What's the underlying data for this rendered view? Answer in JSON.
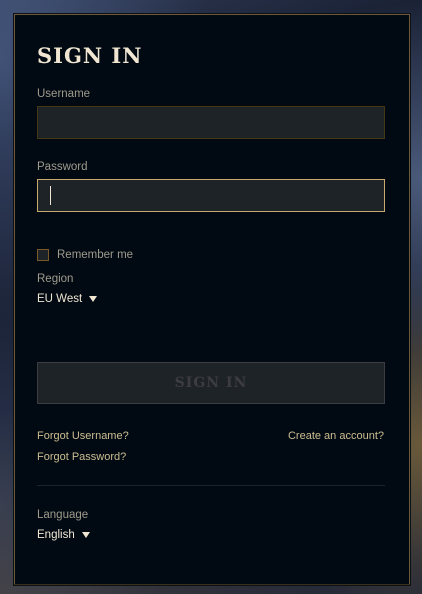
{
  "form": {
    "title": "SIGN IN",
    "username": {
      "label": "Username",
      "value": "",
      "placeholder": ""
    },
    "password": {
      "label": "Password",
      "value": "",
      "placeholder": ""
    },
    "remember_label": "Remember me",
    "remember_checked": false,
    "region": {
      "label": "Region",
      "value": "EU West"
    },
    "submit_label": "SIGN IN",
    "forgot_username": "Forgot Username?",
    "forgot_password": "Forgot Password?",
    "create_account": "Create an account?",
    "language": {
      "label": "Language",
      "value": "English"
    }
  },
  "colors": {
    "panel_bg": "#010a13",
    "gold_border": "#785a28",
    "text_gold": "#cdbe91",
    "text_light": "#f0e6d2",
    "label_grey": "#a09b8c",
    "disabled_button": "#3c3c41"
  },
  "icons": {
    "dropdown": "chevron-down-icon"
  }
}
